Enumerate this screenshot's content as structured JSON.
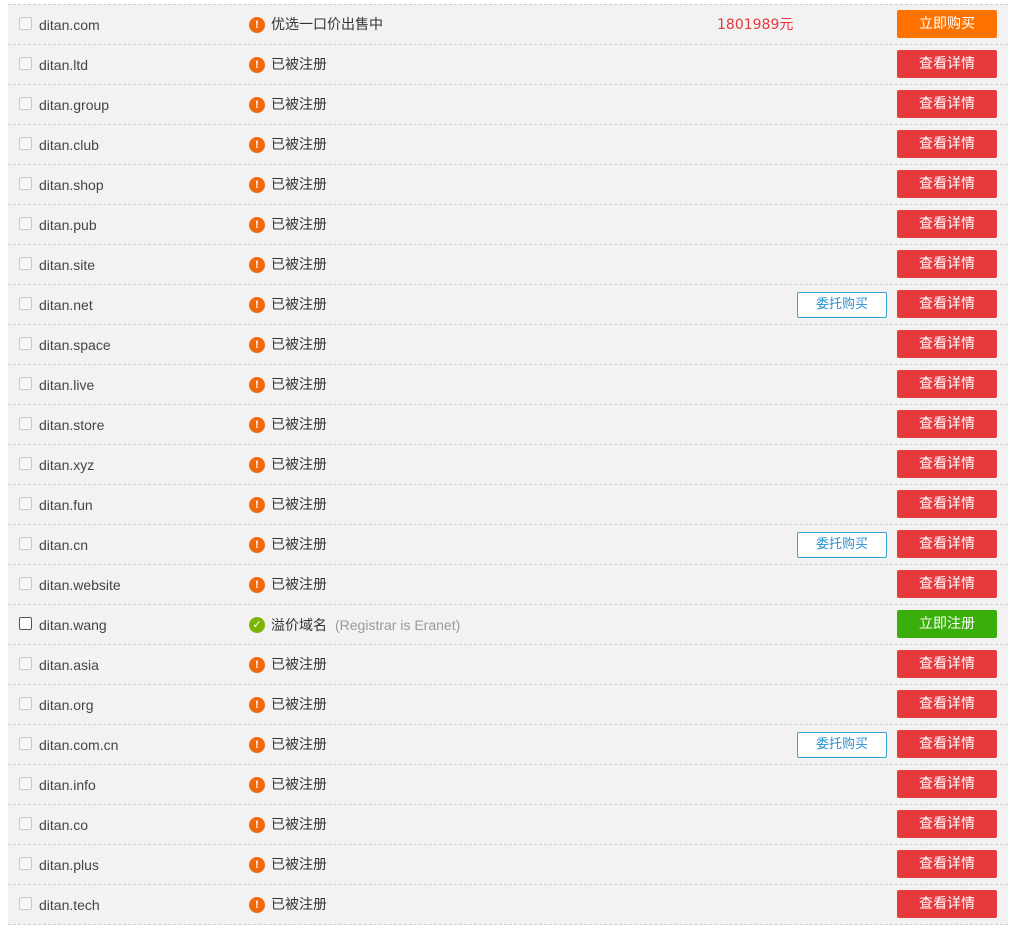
{
  "icons": {
    "warn": "exclamation-icon",
    "ok": "check-icon"
  },
  "colors": {
    "detail": "#e5393c",
    "buy": "#ff7200",
    "register": "#3aae0b",
    "price": "#e4393c",
    "consign": "#2a8fce"
  },
  "rows": [
    {
      "domain": "ditan.com",
      "status": "优选一口价出售中",
      "status_type": "warn",
      "price": "1801989元",
      "consign": "",
      "action": "立即购买",
      "action_type": "orange",
      "checkbox_enabled": false,
      "note": ""
    },
    {
      "domain": "ditan.ltd",
      "status": "已被注册",
      "status_type": "warn",
      "price": "",
      "consign": "",
      "action": "查看详情",
      "action_type": "red",
      "checkbox_enabled": false,
      "note": ""
    },
    {
      "domain": "ditan.group",
      "status": "已被注册",
      "status_type": "warn",
      "price": "",
      "consign": "",
      "action": "查看详情",
      "action_type": "red",
      "checkbox_enabled": false,
      "note": ""
    },
    {
      "domain": "ditan.club",
      "status": "已被注册",
      "status_type": "warn",
      "price": "",
      "consign": "",
      "action": "查看详情",
      "action_type": "red",
      "checkbox_enabled": false,
      "note": ""
    },
    {
      "domain": "ditan.shop",
      "status": "已被注册",
      "status_type": "warn",
      "price": "",
      "consign": "",
      "action": "查看详情",
      "action_type": "red",
      "checkbox_enabled": false,
      "note": ""
    },
    {
      "domain": "ditan.pub",
      "status": "已被注册",
      "status_type": "warn",
      "price": "",
      "consign": "",
      "action": "查看详情",
      "action_type": "red",
      "checkbox_enabled": false,
      "note": ""
    },
    {
      "domain": "ditan.site",
      "status": "已被注册",
      "status_type": "warn",
      "price": "",
      "consign": "",
      "action": "查看详情",
      "action_type": "red",
      "checkbox_enabled": false,
      "note": ""
    },
    {
      "domain": "ditan.net",
      "status": "已被注册",
      "status_type": "warn",
      "price": "",
      "consign": "委托购买",
      "action": "查看详情",
      "action_type": "red",
      "checkbox_enabled": false,
      "note": ""
    },
    {
      "domain": "ditan.space",
      "status": "已被注册",
      "status_type": "warn",
      "price": "",
      "consign": "",
      "action": "查看详情",
      "action_type": "red",
      "checkbox_enabled": false,
      "note": ""
    },
    {
      "domain": "ditan.live",
      "status": "已被注册",
      "status_type": "warn",
      "price": "",
      "consign": "",
      "action": "查看详情",
      "action_type": "red",
      "checkbox_enabled": false,
      "note": ""
    },
    {
      "domain": "ditan.store",
      "status": "已被注册",
      "status_type": "warn",
      "price": "",
      "consign": "",
      "action": "查看详情",
      "action_type": "red",
      "checkbox_enabled": false,
      "note": ""
    },
    {
      "domain": "ditan.xyz",
      "status": "已被注册",
      "status_type": "warn",
      "price": "",
      "consign": "",
      "action": "查看详情",
      "action_type": "red",
      "checkbox_enabled": false,
      "note": ""
    },
    {
      "domain": "ditan.fun",
      "status": "已被注册",
      "status_type": "warn",
      "price": "",
      "consign": "",
      "action": "查看详情",
      "action_type": "red",
      "checkbox_enabled": false,
      "note": ""
    },
    {
      "domain": "ditan.cn",
      "status": "已被注册",
      "status_type": "warn",
      "price": "",
      "consign": "委托购买",
      "action": "查看详情",
      "action_type": "red",
      "checkbox_enabled": false,
      "note": ""
    },
    {
      "domain": "ditan.website",
      "status": "已被注册",
      "status_type": "warn",
      "price": "",
      "consign": "",
      "action": "查看详情",
      "action_type": "red",
      "checkbox_enabled": false,
      "note": ""
    },
    {
      "domain": "ditan.wang",
      "status": "溢价域名",
      "status_type": "ok",
      "price": "",
      "consign": "",
      "action": "立即注册",
      "action_type": "green",
      "checkbox_enabled": true,
      "note": "(Registrar is Eranet)"
    },
    {
      "domain": "ditan.asia",
      "status": "已被注册",
      "status_type": "warn",
      "price": "",
      "consign": "",
      "action": "查看详情",
      "action_type": "red",
      "checkbox_enabled": false,
      "note": ""
    },
    {
      "domain": "ditan.org",
      "status": "已被注册",
      "status_type": "warn",
      "price": "",
      "consign": "",
      "action": "查看详情",
      "action_type": "red",
      "checkbox_enabled": false,
      "note": ""
    },
    {
      "domain": "ditan.com.cn",
      "status": "已被注册",
      "status_type": "warn",
      "price": "",
      "consign": "委托购买",
      "action": "查看详情",
      "action_type": "red",
      "checkbox_enabled": false,
      "note": ""
    },
    {
      "domain": "ditan.info",
      "status": "已被注册",
      "status_type": "warn",
      "price": "",
      "consign": "",
      "action": "查看详情",
      "action_type": "red",
      "checkbox_enabled": false,
      "note": ""
    },
    {
      "domain": "ditan.co",
      "status": "已被注册",
      "status_type": "warn",
      "price": "",
      "consign": "",
      "action": "查看详情",
      "action_type": "red",
      "checkbox_enabled": false,
      "note": ""
    },
    {
      "domain": "ditan.plus",
      "status": "已被注册",
      "status_type": "warn",
      "price": "",
      "consign": "",
      "action": "查看详情",
      "action_type": "red",
      "checkbox_enabled": false,
      "note": ""
    },
    {
      "domain": "ditan.tech",
      "status": "已被注册",
      "status_type": "warn",
      "price": "",
      "consign": "",
      "action": "查看详情",
      "action_type": "red",
      "checkbox_enabled": false,
      "note": ""
    }
  ]
}
